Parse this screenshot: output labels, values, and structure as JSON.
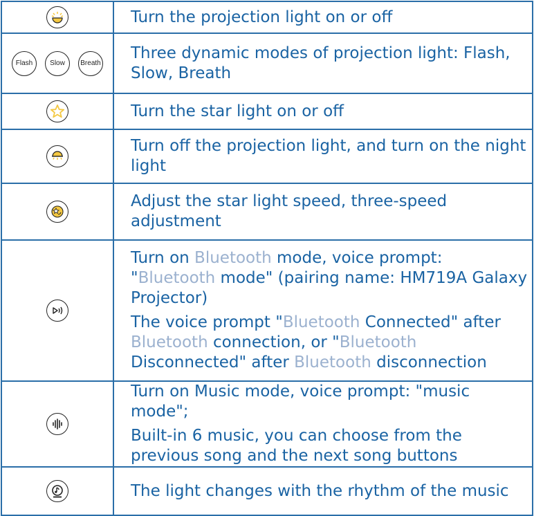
{
  "rows": [
    {
      "icon": "projection-light-icon",
      "segments": [
        [
          "Turn the projection light on or off",
          false
        ]
      ]
    },
    {
      "icon": "mode-buttons",
      "modes": [
        "Flash",
        "Slow",
        "Breath"
      ],
      "segments": [
        [
          "Three dynamic modes of projection light: Flash, Slow, Breath",
          false
        ]
      ]
    },
    {
      "icon": "star-icon",
      "segments": [
        [
          "Turn the star light on or off",
          false
        ]
      ]
    },
    {
      "icon": "night-light-icon",
      "segments": [
        [
          "Turn off the projection light, and turn on the night light",
          false
        ]
      ]
    },
    {
      "icon": "speed-icon",
      "segments": [
        [
          "Adjust the star light speed, three-speed adjustment",
          false
        ]
      ]
    },
    {
      "icon": "bluetooth-play-icon",
      "p1": [
        [
          "Turn on ",
          false
        ],
        [
          "Bluetooth",
          true
        ],
        [
          " mode, voice prompt: \"",
          false
        ],
        [
          "Bluetooth",
          true
        ],
        [
          " mode\" (pairing name: HM719A Galaxy Projector)",
          false
        ]
      ],
      "p2": [
        [
          "The voice prompt \"",
          false
        ],
        [
          "Bluetooth",
          true
        ],
        [
          " Connected\" after ",
          false
        ],
        [
          "Bluetooth",
          true
        ],
        [
          " connection, or \"",
          false
        ],
        [
          "Bluetooth",
          true
        ],
        [
          " Disconnected\" after ",
          false
        ],
        [
          "Bluetooth",
          true
        ],
        [
          " disconnection",
          false
        ]
      ]
    },
    {
      "icon": "music-wave-icon",
      "p1": [
        [
          "Turn on Music mode, voice prompt: \"music mode\";",
          false
        ]
      ],
      "p2": [
        [
          "Built-in 6 music, you can choose from the previous song and the next song buttons",
          false
        ]
      ]
    },
    {
      "icon": "music-note-icon",
      "segments": [
        [
          "The light changes with the rhythm of the music",
          false
        ]
      ]
    }
  ],
  "colors": {
    "border": "#2a6ea8",
    "text": "#1a63a3",
    "muted": "#9bb1cf",
    "icon_fill": "#f4c842"
  }
}
